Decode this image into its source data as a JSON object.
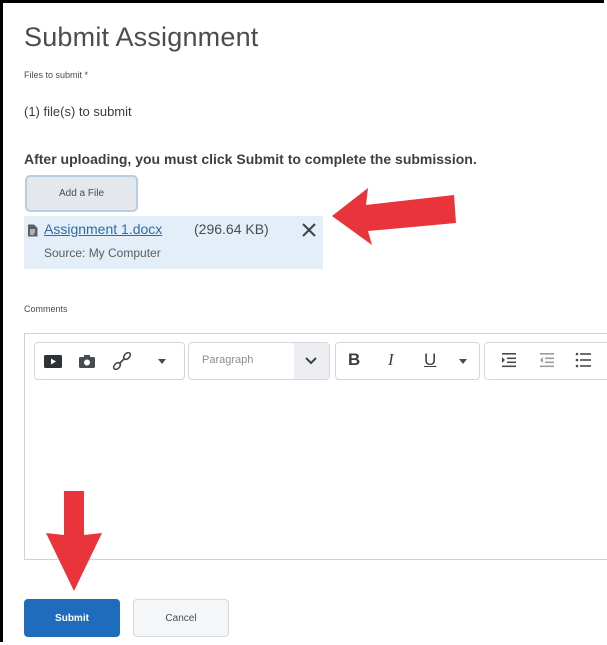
{
  "page": {
    "title": "Submit Assignment"
  },
  "files": {
    "label": "Files to submit *",
    "count_text": "(1) file(s) to submit",
    "instruction": "After uploading, you must click Submit to complete the submission.",
    "add_file_label": "Add a File",
    "items": [
      {
        "name": "Assignment 1.docx",
        "size": "(296.64 KB)",
        "source": "Source: My Computer"
      }
    ]
  },
  "comments": {
    "label": "Comments",
    "toolbar": {
      "insert_icons": [
        "video-icon",
        "camera-icon",
        "link-icon",
        "dropdown-caret-icon"
      ],
      "format_value": "Paragraph",
      "bold": "B",
      "italic": "I",
      "underline": "U",
      "paragraph_icons": [
        "indent-icon",
        "outdent-icon",
        "bullet-list-icon"
      ]
    }
  },
  "actions": {
    "submit_label": "Submit",
    "cancel_label": "Cancel"
  },
  "annotations": {
    "arrow_color": "#e8343a",
    "arrows": [
      "arrow-pointing-left-icon",
      "arrow-pointing-down-icon"
    ]
  },
  "colors": {
    "primary": "#1f6cbd",
    "link": "#2a6ea8",
    "file_card_bg": "#e4eef8"
  }
}
